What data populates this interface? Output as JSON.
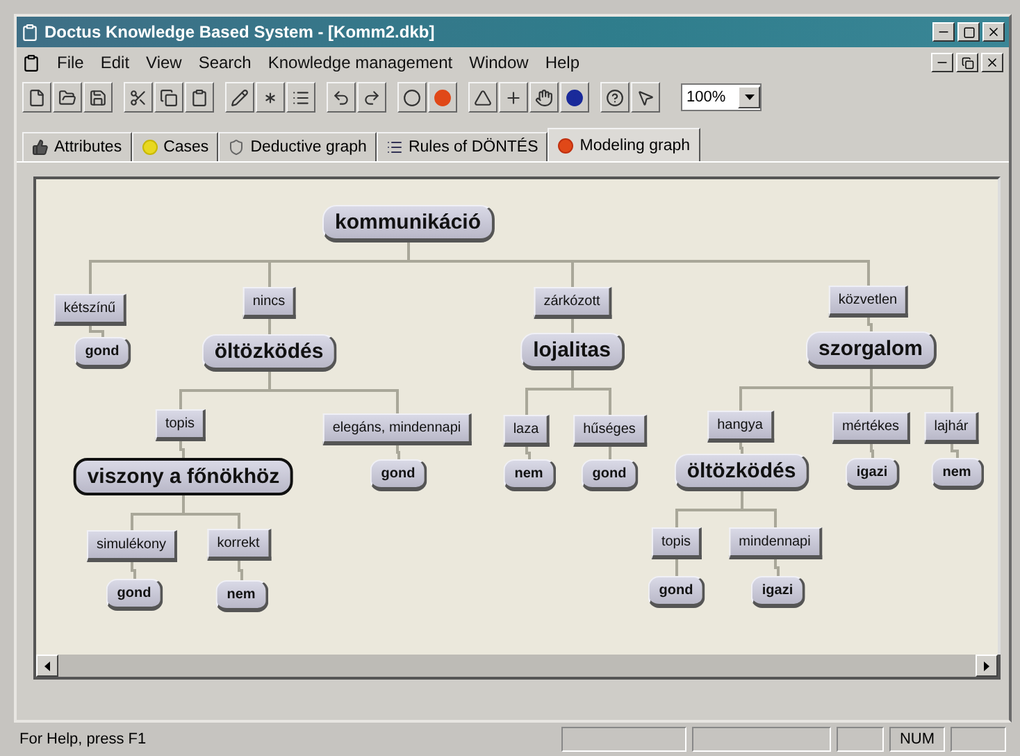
{
  "window": {
    "title": "Doctus Knowledge Based System - [Komm2.dkb]"
  },
  "menu": [
    "File",
    "Edit",
    "View",
    "Search",
    "Knowledge management",
    "Window",
    "Help"
  ],
  "toolbar": {
    "zoom": "100%"
  },
  "tabs": [
    {
      "label": "Attributes",
      "selected": false
    },
    {
      "label": "Cases",
      "selected": false
    },
    {
      "label": "Deductive graph",
      "selected": false
    },
    {
      "label": "Rules of DÖNTÉS",
      "selected": false
    },
    {
      "label": "Modeling graph",
      "selected": true
    }
  ],
  "graph": {
    "root": {
      "kind": "attribute",
      "label": "kommunikáció",
      "selected": false,
      "children": [
        {
          "kind": "value",
          "label": "kétszínű",
          "selected": false,
          "children": [
            {
              "kind": "result",
              "label": "gond",
              "selected": false
            }
          ]
        },
        {
          "kind": "value",
          "label": "nincs",
          "selected": false,
          "children": [
            {
              "kind": "attribute",
              "label": "öltözködés",
              "selected": false,
              "children": [
                {
                  "kind": "value",
                  "label": "topis",
                  "selected": false,
                  "children": [
                    {
                      "kind": "attribute",
                      "label": "viszony a főnökhöz",
                      "selected": true,
                      "children": [
                        {
                          "kind": "value",
                          "label": "simulékony",
                          "selected": false,
                          "children": [
                            {
                              "kind": "result",
                              "label": "gond",
                              "selected": false
                            }
                          ]
                        },
                        {
                          "kind": "value",
                          "label": "korrekt",
                          "selected": false,
                          "children": [
                            {
                              "kind": "result",
                              "label": "nem",
                              "selected": false
                            }
                          ]
                        }
                      ]
                    }
                  ]
                },
                {
                  "kind": "value",
                  "label": "elegáns, mindennapi",
                  "selected": false,
                  "children": [
                    {
                      "kind": "result",
                      "label": "gond",
                      "selected": false
                    }
                  ]
                }
              ]
            }
          ]
        },
        {
          "kind": "value",
          "label": "zárkózott",
          "selected": false,
          "children": [
            {
              "kind": "attribute",
              "label": "lojalitas",
              "selected": false,
              "children": [
                {
                  "kind": "value",
                  "label": "laza",
                  "selected": false,
                  "children": [
                    {
                      "kind": "result",
                      "label": "nem",
                      "selected": false
                    }
                  ]
                },
                {
                  "kind": "value",
                  "label": "hűséges",
                  "selected": false,
                  "children": [
                    {
                      "kind": "result",
                      "label": "gond",
                      "selected": false
                    }
                  ]
                }
              ]
            }
          ]
        },
        {
          "kind": "value",
          "label": "közvetlen",
          "selected": false,
          "children": [
            {
              "kind": "attribute",
              "label": "szorgalom",
              "selected": false,
              "children": [
                {
                  "kind": "value",
                  "label": "hangya",
                  "selected": false,
                  "children": [
                    {
                      "kind": "attribute",
                      "label": "öltözködés",
                      "selected": false,
                      "children": [
                        {
                          "kind": "value",
                          "label": "topis",
                          "selected": false,
                          "children": [
                            {
                              "kind": "result",
                              "label": "gond",
                              "selected": false
                            }
                          ]
                        },
                        {
                          "kind": "value",
                          "label": "mindennapi",
                          "selected": false,
                          "children": [
                            {
                              "kind": "result",
                              "label": "igazi",
                              "selected": false
                            }
                          ]
                        }
                      ]
                    }
                  ]
                },
                {
                  "kind": "value",
                  "label": "mértékes",
                  "selected": false,
                  "children": [
                    {
                      "kind": "result",
                      "label": "igazi",
                      "selected": false
                    }
                  ]
                },
                {
                  "kind": "value",
                  "label": "lajhár",
                  "selected": false,
                  "children": [
                    {
                      "kind": "result",
                      "label": "nem",
                      "selected": false
                    }
                  ]
                }
              ]
            }
          ]
        }
      ]
    }
  },
  "status_bar": {
    "help": "For Help, press F1",
    "num": "NUM"
  }
}
